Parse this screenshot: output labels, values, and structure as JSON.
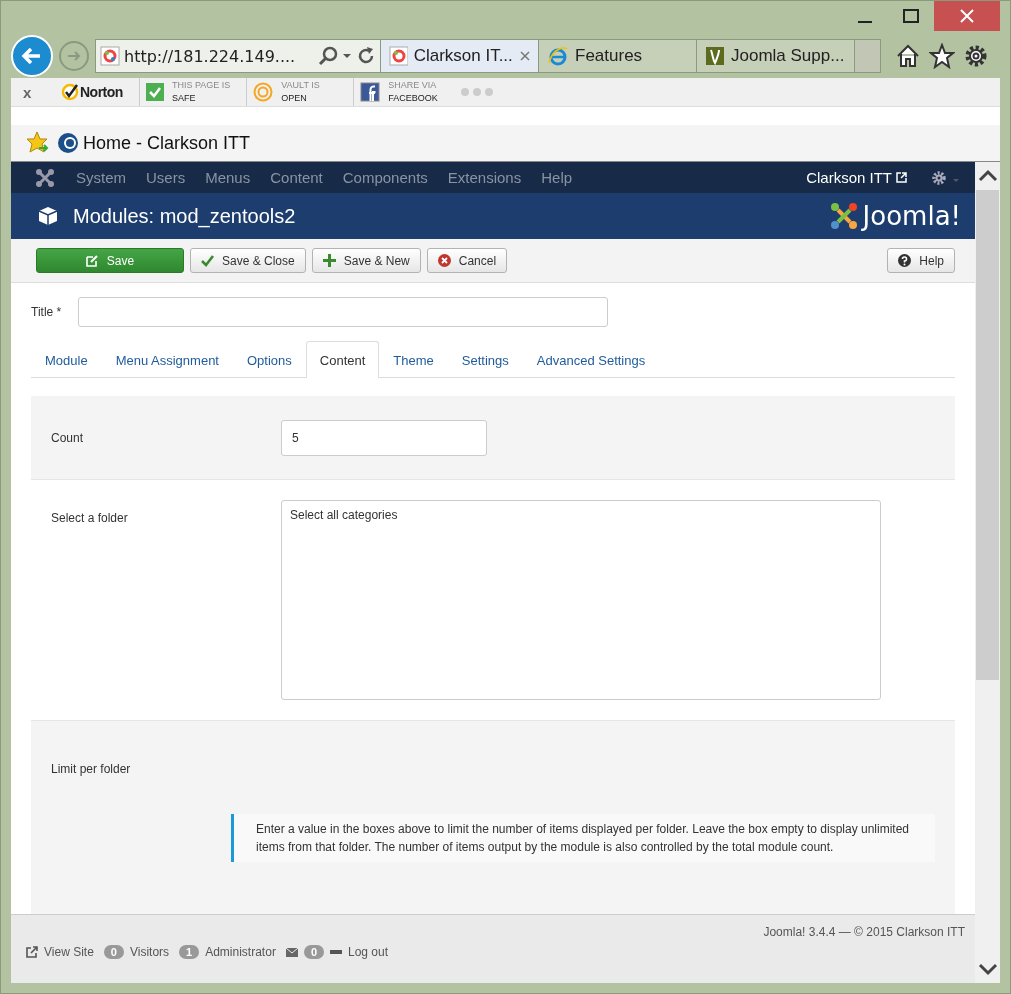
{
  "browser": {
    "address": "http://181.224.149....",
    "tabs": [
      {
        "title": "Clarkson IT...",
        "selected": true
      },
      {
        "title": "Features",
        "selected": false
      },
      {
        "title": "Joomla Supp...",
        "selected": false
      }
    ],
    "norton": {
      "close": "x",
      "brand": "Norton",
      "items": [
        {
          "caption": "THIS PAGE IS",
          "value": "SAFE"
        },
        {
          "caption": "VAULT IS",
          "value": "OPEN"
        },
        {
          "caption": "SHARE VIA",
          "value": "FACEBOOK"
        }
      ]
    },
    "favorites": [
      {
        "label": "Home - Clarkson ITT"
      }
    ]
  },
  "admin": {
    "menu": [
      "System",
      "Users",
      "Menus",
      "Content",
      "Components",
      "Extensions",
      "Help"
    ],
    "site_link": "Clarkson ITT",
    "page_title": "Modules: mod_zentools2",
    "logo": "Joomla!",
    "toolbar": [
      {
        "label": "Save",
        "kind": "primary"
      },
      {
        "label": "Save & Close",
        "kind": "default"
      },
      {
        "label": "Save & New",
        "kind": "default"
      },
      {
        "label": "Cancel",
        "kind": "default"
      }
    ],
    "help_button": "Help",
    "title_field": {
      "label": "Title *"
    },
    "tabs": [
      {
        "label": "Module",
        "selected": false
      },
      {
        "label": "Menu Assignment",
        "selected": false
      },
      {
        "label": "Options",
        "selected": false
      },
      {
        "label": "Content",
        "selected": true
      },
      {
        "label": "Theme",
        "selected": false
      },
      {
        "label": "Settings",
        "selected": false
      },
      {
        "label": "Advanced Settings",
        "selected": false
      }
    ],
    "fields": [
      {
        "kind": "text",
        "label": "Count",
        "value": "5"
      },
      {
        "kind": "listbox",
        "label": "Select a folder",
        "options": [
          "Select all categories"
        ]
      },
      {
        "kind": "note",
        "label": "Limit per folder",
        "note": "Enter a value in the boxes above to limit the number of items displayed per folder. Leave the box empty to display unlimited items from that folder. The number of items output by the module is also controlled by the total module count."
      }
    ],
    "footer": {
      "version": "Joomla! 3.4.4 — © 2015 Clarkson ITT",
      "view_site": "View Site",
      "visitors": {
        "count": "0",
        "label": "Visitors"
      },
      "admins": {
        "count": "1",
        "label": "Administrator"
      },
      "messages": {
        "count": "0"
      },
      "logout": "Log out"
    }
  }
}
